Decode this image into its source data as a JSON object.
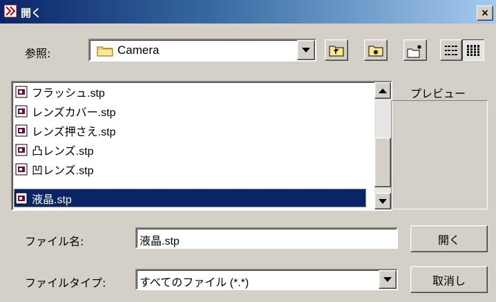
{
  "window": {
    "title": "開く",
    "close_label": "×"
  },
  "lookin": {
    "label": "参照:",
    "value": "Camera"
  },
  "toolbar": {
    "icons": [
      "folder-up-icon",
      "desktop-icon",
      "new-folder-icon",
      "list-view-icon",
      "details-view-icon"
    ]
  },
  "files": [
    {
      "name": "フラッシュ.stp",
      "selected": false
    },
    {
      "name": "レンズカバー.stp",
      "selected": false
    },
    {
      "name": "レンズ押さえ.stp",
      "selected": false
    },
    {
      "name": "凸レンズ.stp",
      "selected": false
    },
    {
      "name": "凹レンズ.stp",
      "selected": false
    },
    {
      "name": "液晶.stp",
      "selected": true
    }
  ],
  "preview": {
    "label": "プレビュー"
  },
  "filename": {
    "label": "ファイル名:",
    "value": "液晶.stp"
  },
  "filetype": {
    "label": "ファイルタイプ:",
    "value": "すべてのファイル (*.*)"
  },
  "buttons": {
    "open": "開く",
    "cancel": "取消し"
  },
  "colors": {
    "titlebar_start": "#0a246a",
    "titlebar_end": "#a6caf0",
    "selection": "#0a246a",
    "face": "#d4d0c8"
  }
}
